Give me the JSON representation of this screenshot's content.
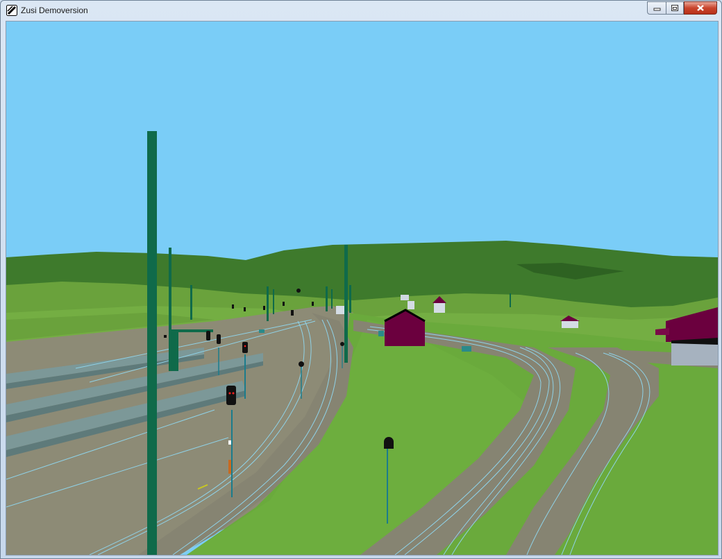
{
  "window": {
    "title": "Zusi Demoversion",
    "icon": "zusi-app-icon",
    "controls": {
      "minimize": "minimize-icon",
      "maximize": "maximize-icon",
      "close": "close-icon"
    }
  },
  "scene": {
    "description_icon": "railway-3d-viewport",
    "colors": {
      "sky": "#7acdf7",
      "hills": "#3f7a2c",
      "meadow": "#6fa83f",
      "ballast": "#8a8a72",
      "mast": "#0f6a4a",
      "building": "#6b003e"
    }
  }
}
